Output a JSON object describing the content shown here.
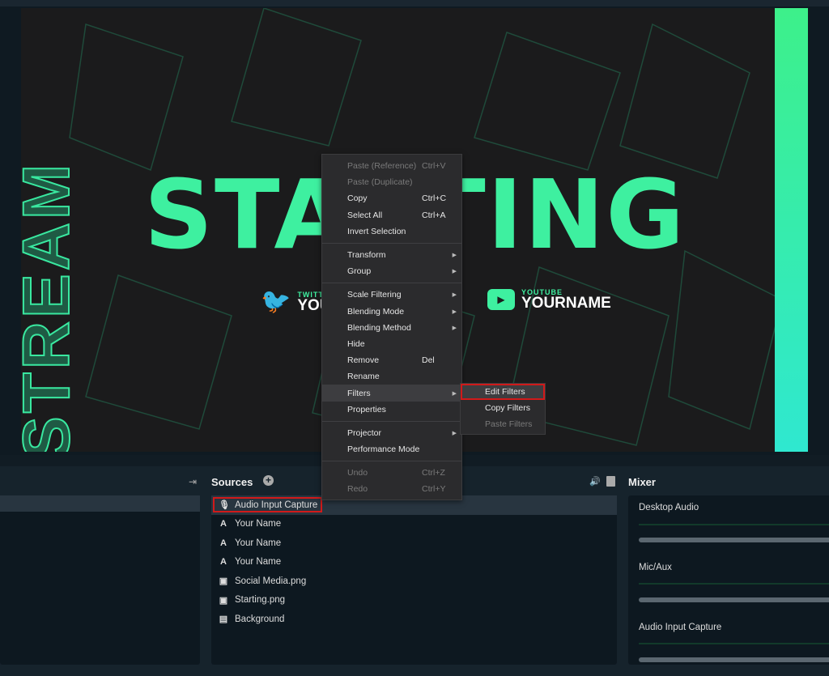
{
  "preview": {
    "side_text": "STREAM",
    "title": "STARTING",
    "twitter": {
      "label": "TWITTER",
      "name": "YOURNAME"
    },
    "youtube": {
      "label": "YOUTUBE",
      "name": "YOURNAME"
    },
    "accent": "#3ef0a0"
  },
  "context_menu": {
    "groups": [
      [
        {
          "label": "Paste (Reference)",
          "shortcut": "Ctrl+V",
          "disabled": true
        },
        {
          "label": "Paste (Duplicate)",
          "disabled": true
        },
        {
          "label": "Copy",
          "shortcut": "Ctrl+C"
        },
        {
          "label": "Select All",
          "shortcut": "Ctrl+A"
        },
        {
          "label": "Invert Selection"
        }
      ],
      [
        {
          "label": "Transform",
          "submenu": true
        },
        {
          "label": "Group",
          "submenu": true
        }
      ],
      [
        {
          "label": "Scale Filtering",
          "submenu": true
        },
        {
          "label": "Blending Mode",
          "submenu": true
        },
        {
          "label": "Blending Method",
          "submenu": true
        },
        {
          "label": "Hide"
        },
        {
          "label": "Remove",
          "shortcut": "Del"
        },
        {
          "label": "Rename"
        },
        {
          "label": "Filters",
          "submenu": true,
          "highlighted": true
        },
        {
          "label": "Properties"
        }
      ],
      [
        {
          "label": "Projector",
          "submenu": true
        },
        {
          "label": "Performance Mode"
        }
      ],
      [
        {
          "label": "Undo",
          "shortcut": "Ctrl+Z",
          "disabled": true
        },
        {
          "label": "Redo",
          "shortcut": "Ctrl+Y",
          "disabled": true
        }
      ]
    ],
    "filters_submenu": [
      {
        "label": "Edit Filters",
        "highlighted": true
      },
      {
        "label": "Copy Filters"
      },
      {
        "label": "Paste Filters",
        "disabled": true
      }
    ]
  },
  "sources": {
    "title": "Sources",
    "items": [
      {
        "label": "Audio Input Capture",
        "icon": "microphone-icon",
        "selected": true
      },
      {
        "label": "Your Name",
        "icon": "text-icon"
      },
      {
        "label": "Your Name",
        "icon": "text-icon"
      },
      {
        "label": "Your Name",
        "icon": "text-icon"
      },
      {
        "label": "Social Media.png",
        "icon": "image-icon"
      },
      {
        "label": "Starting.png",
        "icon": "image-icon"
      },
      {
        "label": "Background",
        "icon": "file-icon"
      }
    ]
  },
  "mixer": {
    "title": "Mixer",
    "channels": [
      {
        "label": "Desktop Audio"
      },
      {
        "label": "Mic/Aux"
      },
      {
        "label": "Audio Input Capture"
      }
    ]
  }
}
